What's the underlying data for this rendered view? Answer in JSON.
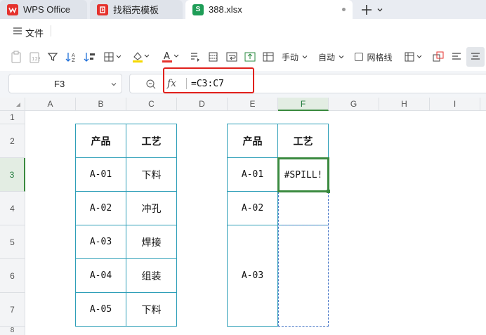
{
  "tabs": [
    {
      "label": "WPS Office",
      "icon": "wps-logo-icon"
    },
    {
      "label": "找稻壳模板",
      "icon": "docer-icon"
    },
    {
      "label": "388.xlsx",
      "icon": "spreadsheet-icon",
      "icon_letter": "S"
    }
  ],
  "menu": {
    "file_label": "文件"
  },
  "toolbar": {
    "manual_label": "手动",
    "auto_label": "自动",
    "gridlines_label": "网格线"
  },
  "formula_bar": {
    "name_box": "F3",
    "fx": "fx",
    "formula": "=C3:C7"
  },
  "columns": [
    "A",
    "B",
    "C",
    "D",
    "E",
    "F",
    "G",
    "H",
    "I"
  ],
  "selected_column": "F",
  "rows": [
    "1",
    "2",
    "3",
    "4",
    "5",
    "6",
    "7",
    "8"
  ],
  "selected_row": "3",
  "table1": {
    "headers": [
      "产品",
      "工艺"
    ],
    "rows": [
      [
        "A-01",
        "下料"
      ],
      [
        "A-02",
        "冲孔"
      ],
      [
        "A-03",
        "焊接"
      ],
      [
        "A-04",
        "组装"
      ],
      [
        "A-05",
        "下料"
      ]
    ]
  },
  "table2": {
    "headers": [
      "产品",
      "工艺"
    ],
    "products": [
      "A-01",
      "A-02",
      "A-03"
    ],
    "spill_value": "#SPILL!"
  },
  "colors": {
    "accent_green": "#3a8a3f",
    "table_border": "#2e9fb8",
    "highlight_red": "#e0201c"
  }
}
